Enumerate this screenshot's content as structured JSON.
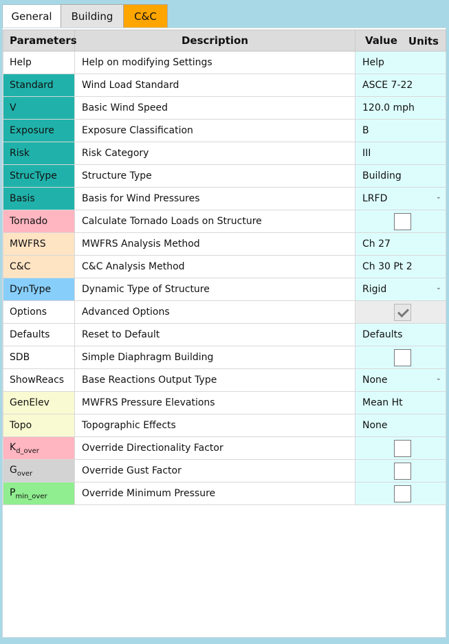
{
  "tabs": [
    {
      "label": "General"
    },
    {
      "label": "Building"
    },
    {
      "label": "C&C"
    }
  ],
  "headers": {
    "parameters": "Parameters",
    "description": "Description",
    "value": "Value",
    "units": "Units"
  },
  "rows": [
    {
      "param": "Help",
      "description": "Help on modifying Settings",
      "value": "Help",
      "color": ""
    },
    {
      "param": "Standard",
      "description": "Wind Load Standard",
      "value": "ASCE 7-22",
      "color": "#20b2aa"
    },
    {
      "param": "V",
      "description": "Basic Wind Speed",
      "value": "120.0 mph",
      "color": "#20b2aa"
    },
    {
      "param": "Exposure",
      "description": "Exposure Classification",
      "value": "B",
      "color": "#20b2aa"
    },
    {
      "param": "Risk",
      "description": "Risk Category",
      "value": "III",
      "color": "#20b2aa"
    },
    {
      "param": "StrucType",
      "description": "Structure Type",
      "value": "Building",
      "color": "#20b2aa"
    },
    {
      "param": "Basis",
      "description": "Basis for Wind Pressures",
      "value": "LRFD",
      "color": "#20b2aa"
    },
    {
      "param": "Tornado",
      "description": "Calculate Tornado Loads on Structure",
      "value": "",
      "color": "#ffb6c1"
    },
    {
      "param": "MWFRS",
      "description": "MWFRS Analysis Method",
      "value": "Ch 27",
      "color": "#ffe4c4"
    },
    {
      "param": "C&C",
      "description": "C&C Analysis Method",
      "value": "Ch 30 Pt 2",
      "color": "#ffe4c4"
    },
    {
      "param": "DynType",
      "description": "Dynamic Type of Structure",
      "value": "Rigid",
      "color": "#87cefa"
    },
    {
      "param": "Options",
      "description": "Advanced Options",
      "value": "",
      "color": ""
    },
    {
      "param": "Defaults",
      "description": "Reset to Default",
      "value": "Defaults",
      "color": ""
    },
    {
      "param": "SDB",
      "description": "Simple Diaphragm Building",
      "value": "",
      "color": ""
    },
    {
      "param": "ShowReacs",
      "description": "Base Reactions Output Type",
      "value": "None",
      "color": ""
    },
    {
      "param": "GenElev",
      "description": "MWFRS Pressure Elevations",
      "value": "Mean Ht",
      "color": "#fafad2"
    },
    {
      "param": "Topo",
      "description": "Topographic Effects",
      "value": "None",
      "color": "#fafad2"
    },
    {
      "param_main": "K",
      "param_sub": "d_over",
      "description": "Override Directionality Factor",
      "value": "",
      "color": "#ffb6c1"
    },
    {
      "param_main": "G",
      "param_sub": "over",
      "description": "Override Gust Factor",
      "value": "",
      "color": "#d3d3d3"
    },
    {
      "param_main": "P",
      "param_sub": "min_over",
      "description": "Override Minimum Pressure",
      "value": "",
      "color": "#90ee90"
    }
  ]
}
